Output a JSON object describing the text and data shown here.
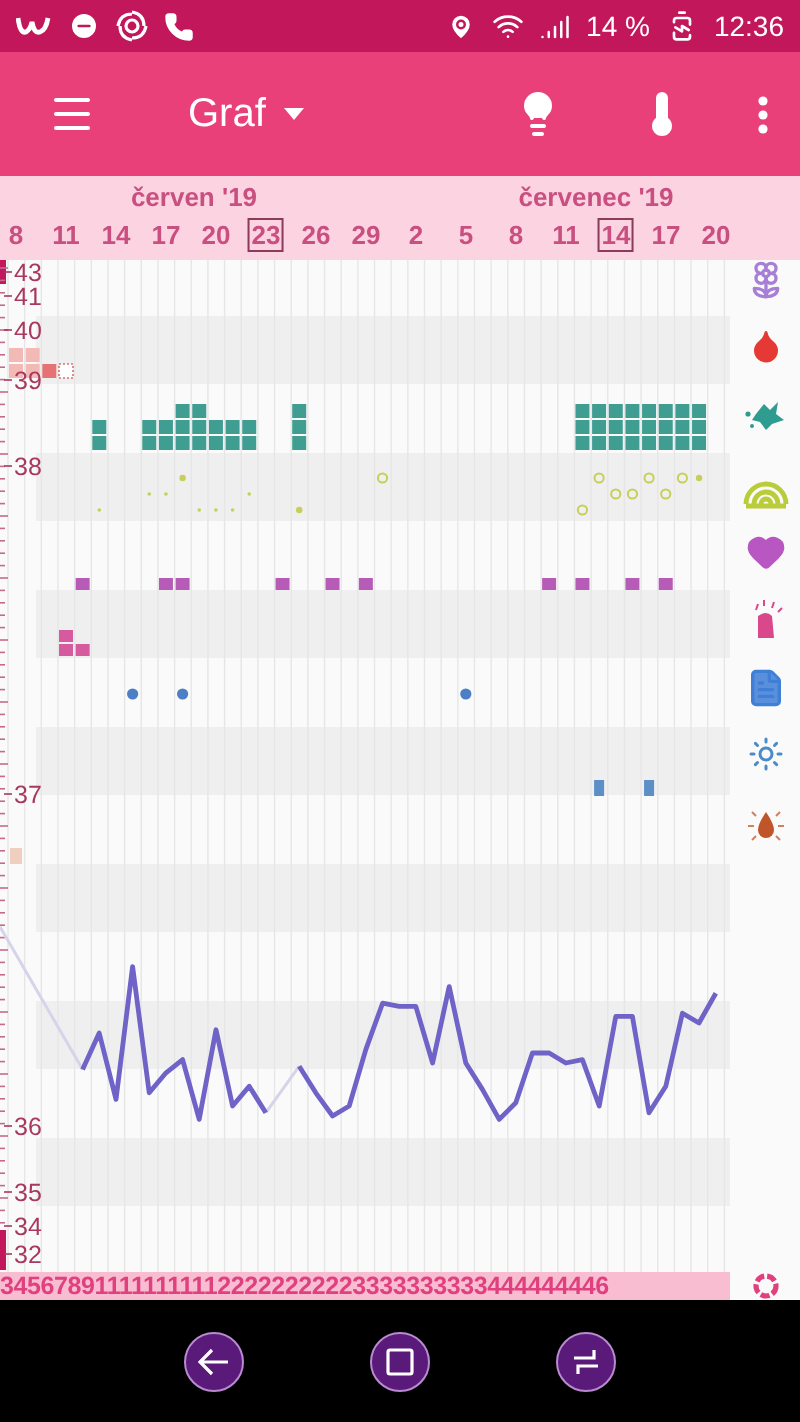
{
  "status_bar": {
    "battery": "14 %",
    "time": "12:36"
  },
  "app_bar": {
    "title": "Graf"
  },
  "date_header": {
    "months": [
      {
        "label": "červen '19"
      },
      {
        "label": "červenec '19"
      }
    ],
    "days": [
      {
        "label": "8",
        "boxed": false
      },
      {
        "label": "11",
        "boxed": false
      },
      {
        "label": "14",
        "boxed": false
      },
      {
        "label": "17",
        "boxed": false
      },
      {
        "label": "20",
        "boxed": false
      },
      {
        "label": "23",
        "boxed": true
      },
      {
        "label": "26",
        "boxed": false
      },
      {
        "label": "29",
        "boxed": false
      },
      {
        "label": "2",
        "boxed": false
      },
      {
        "label": "5",
        "boxed": false
      },
      {
        "label": "8",
        "boxed": false
      },
      {
        "label": "11",
        "boxed": false
      },
      {
        "label": "14",
        "boxed": true
      },
      {
        "label": "17",
        "boxed": false
      },
      {
        "label": "20",
        "boxed": false
      }
    ]
  },
  "tracks": [
    {
      "kind": "flower"
    },
    {
      "kind": "bleeding"
    },
    {
      "kind": "splash"
    },
    {
      "kind": "rings"
    },
    {
      "kind": "heart"
    },
    {
      "kind": "hand"
    },
    {
      "kind": "document"
    },
    {
      "kind": "snowflake"
    },
    {
      "kind": "dropsun"
    }
  ],
  "temperature_axis": {
    "labels": [
      "43",
      "41",
      "40",
      "39",
      "38",
      "37",
      "36",
      "35",
      "34",
      "32"
    ]
  },
  "cycle_days": "3456789111111111122222222223333333333444444446"
}
